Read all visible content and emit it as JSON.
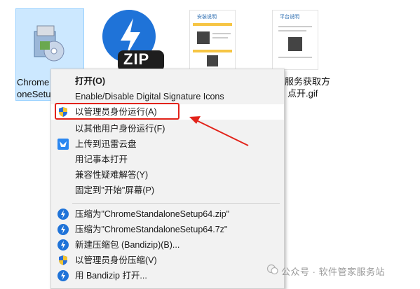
{
  "desktop": {
    "files": [
      {
        "label_line1": "Chrome",
        "label_line2": "oneSetu"
      },
      {
        "badge": "ZIP"
      },
      {
        "doc_heading": "安装说明"
      },
      {
        "doc_heading": "平台说明",
        "label_line1": "服务获取方",
        "label_line2": "点开.gif"
      }
    ]
  },
  "context_menu": {
    "items": [
      {
        "label": "打开(O)"
      },
      {
        "label": "Enable/Disable Digital Signature Icons"
      },
      {
        "label": "以管理员身份运行(A)"
      },
      {
        "label": "以其他用户身份运行(F)"
      },
      {
        "label": "上传到迅雷云盘"
      },
      {
        "label": "用记事本打开"
      },
      {
        "label": "兼容性疑难解答(Y)"
      },
      {
        "label": "固定到\"开始\"屏幕(P)"
      },
      {
        "label": "压缩为\"ChromeStandaloneSetup64.zip\""
      },
      {
        "label": "压缩为\"ChromeStandaloneSetup64.7z\""
      },
      {
        "label": "新建压缩包 (Bandizip)(B)..."
      },
      {
        "label": "以管理员身份压缩(V)"
      },
      {
        "label": "用 Bandizip 打开..."
      }
    ]
  },
  "watermark": {
    "text": "公众号 · 软件管家服务站"
  },
  "colors": {
    "highlight_border": "#e2231a",
    "arrow": "#e2231a",
    "bandizip_blue": "#1f73d8",
    "selection": "#cce8ff"
  }
}
